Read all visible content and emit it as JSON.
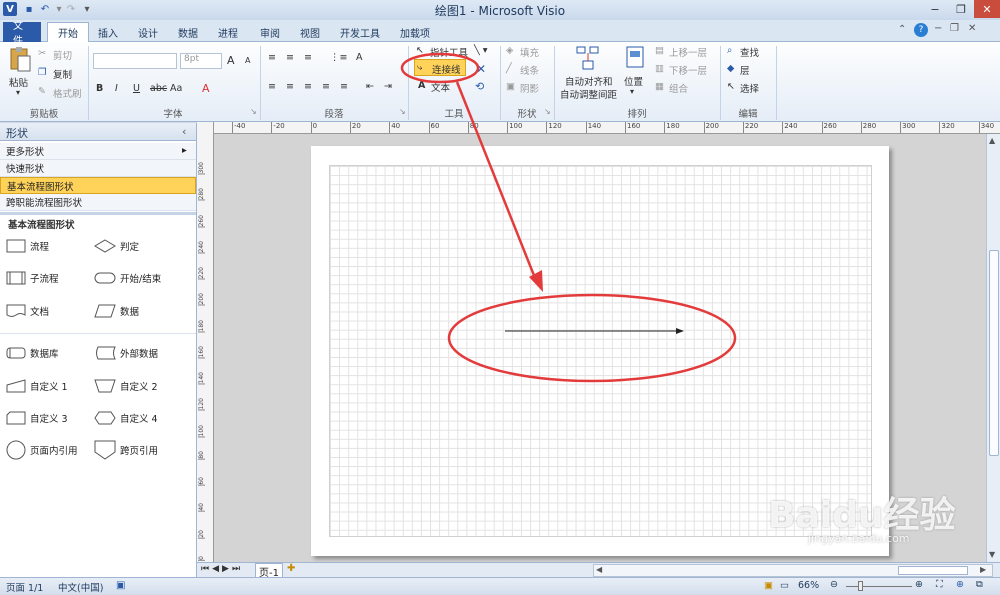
{
  "window": {
    "title": "绘图1 - Microsoft Visio",
    "app_icon": "V"
  },
  "tabs": [
    {
      "label": "文件"
    },
    {
      "label": "开始"
    },
    {
      "label": "插入"
    },
    {
      "label": "设计"
    },
    {
      "label": "数据"
    },
    {
      "label": "进程"
    },
    {
      "label": "审阅"
    },
    {
      "label": "视图"
    },
    {
      "label": "开发工具"
    },
    {
      "label": "加载项"
    }
  ],
  "ribbon": {
    "clipboard": {
      "paste": "粘贴",
      "cut": "剪切",
      "copy": "复制",
      "format_painter": "格式刷",
      "label": "剪贴板"
    },
    "font": {
      "font_size": "8pt",
      "bold": "B",
      "italic": "I",
      "underline": "U",
      "strike": "abc",
      "case": "Aa",
      "color": "A",
      "grow": "A",
      "shrink": "A",
      "label": "字体"
    },
    "paragraph": {
      "label": "段落"
    },
    "tools": {
      "pointer": "指针工具",
      "connector": "连接线",
      "text": "文本",
      "label": "工具"
    },
    "shape": {
      "fill": "填充",
      "line": "线条",
      "shadow": "阴影",
      "label": "形状"
    },
    "arrange": {
      "auto_align": "自动对齐和",
      "auto_space": "自动调整间距",
      "position": "位置",
      "bring_forward": "上移一层",
      "send_backward": "下移一层",
      "group": "组合",
      "label": "排列"
    },
    "editing": {
      "find": "查找",
      "layers": "层",
      "select": "选择",
      "label": "编辑"
    }
  },
  "shapes_panel": {
    "title": "形状",
    "more_shapes": "更多形状",
    "quick_shapes": "快速形状",
    "basic_flowchart": "基本流程图形状",
    "cross_functional": "跨职能流程图形状",
    "stencil_title": "基本流程图形状",
    "items": [
      {
        "label": "流程",
        "icon": "process-shape-icon"
      },
      {
        "label": "判定",
        "icon": "decision-shape-icon"
      },
      {
        "label": "子流程",
        "icon": "subprocess-shape-icon"
      },
      {
        "label": "开始/结束",
        "icon": "terminator-shape-icon"
      },
      {
        "label": "文档",
        "icon": "document-shape-icon"
      },
      {
        "label": "数据",
        "icon": "data-shape-icon"
      },
      {
        "label": "数据库",
        "icon": "database-shape-icon"
      },
      {
        "label": "外部数据",
        "icon": "external-data-shape-icon"
      },
      {
        "label": "自定义 1",
        "icon": "custom1-shape-icon"
      },
      {
        "label": "自定义 2",
        "icon": "custom2-shape-icon"
      },
      {
        "label": "自定义 3",
        "icon": "custom3-shape-icon"
      },
      {
        "label": "自定义 4",
        "icon": "custom4-shape-icon"
      },
      {
        "label": "页面内引用",
        "icon": "on-page-ref-icon"
      },
      {
        "label": "跨页引用",
        "icon": "off-page-ref-icon"
      }
    ]
  },
  "ruler": {
    "h_ticks": [
      "-40",
      "-20",
      "0",
      "20",
      "40",
      "60",
      "80",
      "100",
      "120",
      "140",
      "160",
      "180",
      "200",
      "220",
      "240",
      "260",
      "280",
      "300",
      "320",
      "340"
    ],
    "v_ticks": [
      "300",
      "280",
      "260",
      "240",
      "220",
      "200",
      "180",
      "160",
      "140",
      "120",
      "100",
      "80",
      "60",
      "40",
      "20",
      "0"
    ]
  },
  "page_tab": {
    "label": "页-1"
  },
  "status": {
    "page": "页面 1/1",
    "language": "中文(中国)",
    "zoom": "66%"
  },
  "watermark": {
    "brand": "Baidu经验",
    "url": "jingyan.baidu.com"
  },
  "colors": {
    "highlight": "#e33b3b",
    "accent": "#2a5aa8",
    "selected_row": "#ffd35a"
  }
}
